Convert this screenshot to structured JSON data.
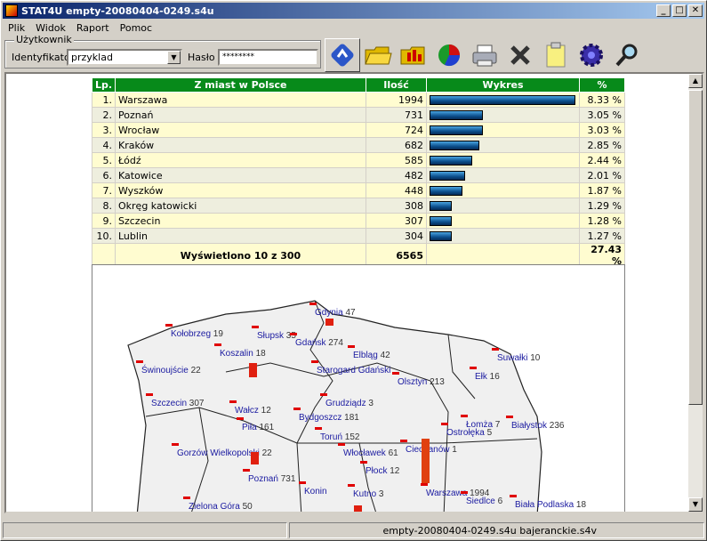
{
  "window": {
    "title": "STAT4U empty-20080404-0249.s4u"
  },
  "menu": [
    "Plik",
    "Widok",
    "Raport",
    "Pomoc"
  ],
  "user": {
    "group_label": "Użytkownik",
    "id_label": "Identyfikator",
    "id_value": "przyklad",
    "pwd_label": "Hasło",
    "pwd_value": "********"
  },
  "toolbar": [
    "refresh-icon",
    "open-folder-icon",
    "open-chart-folder-icon",
    "pie-chart-icon",
    "printer-icon",
    "delete-icon",
    "clipboard-icon",
    "settings-gear-icon",
    "search-icon"
  ],
  "table": {
    "headers": [
      "Lp.",
      "Z miast w Polsce",
      "Ilość",
      "Wykres",
      "%"
    ],
    "rows": [
      {
        "lp": "1.",
        "city": "Warszawa",
        "count": "1994",
        "share": 1.0,
        "pct": "8.33 %"
      },
      {
        "lp": "2.",
        "city": "Poznań",
        "count": "731",
        "share": 0.367,
        "pct": "3.05 %"
      },
      {
        "lp": "3.",
        "city": "Wrocław",
        "count": "724",
        "share": 0.363,
        "pct": "3.03 %"
      },
      {
        "lp": "4.",
        "city": "Kraków",
        "count": "682",
        "share": 0.342,
        "pct": "2.85 %"
      },
      {
        "lp": "5.",
        "city": "Łódź",
        "count": "585",
        "share": 0.293,
        "pct": "2.44 %"
      },
      {
        "lp": "6.",
        "city": "Katowice",
        "count": "482",
        "share": 0.242,
        "pct": "2.01 %"
      },
      {
        "lp": "7.",
        "city": "Wyszków",
        "count": "448",
        "share": 0.225,
        "pct": "1.87 %"
      },
      {
        "lp": "8.",
        "city": "Okręg katowicki",
        "count": "308",
        "share": 0.154,
        "pct": "1.29 %"
      },
      {
        "lp": "9.",
        "city": "Szczecin",
        "count": "307",
        "share": 0.154,
        "pct": "1.28 %"
      },
      {
        "lp": "10.",
        "city": "Lublin",
        "count": "304",
        "share": 0.152,
        "pct": "1.27 %"
      }
    ],
    "footer": {
      "label": "Wyświetlono 10 z 300",
      "total": "6565",
      "pct": "27.43 %"
    }
  },
  "map": {
    "labels": [
      {
        "city": "Gdynia",
        "n": "47"
      },
      {
        "city": "Kołobrzeg",
        "n": "19"
      },
      {
        "city": "Słupsk",
        "n": "35"
      },
      {
        "city": "Gdańsk",
        "n": "274"
      },
      {
        "city": "Koszalin",
        "n": "18"
      },
      {
        "city": "Elbląg",
        "n": "42"
      },
      {
        "city": "Suwałki",
        "n": "10"
      },
      {
        "city": "Świnoujście",
        "n": "22"
      },
      {
        "city": "Starogard Gdański",
        "n": ""
      },
      {
        "city": "Olsztyn",
        "n": "213"
      },
      {
        "city": "Ełk",
        "n": "16"
      },
      {
        "city": "Szczecin",
        "n": "307"
      },
      {
        "city": "Grudziądz",
        "n": "3"
      },
      {
        "city": "Wałcz",
        "n": "12"
      },
      {
        "city": "Bydgoszcz",
        "n": "181"
      },
      {
        "city": "Łomża",
        "n": "7"
      },
      {
        "city": "Piła",
        "n": "161"
      },
      {
        "city": "Ostrołęka",
        "n": "5"
      },
      {
        "city": "Białystok",
        "n": "236"
      },
      {
        "city": "Toruń",
        "n": "152"
      },
      {
        "city": "Ciechanów",
        "n": "1"
      },
      {
        "city": "Gorzów Wielkopolski",
        "n": "22"
      },
      {
        "city": "Włocławek",
        "n": "61"
      },
      {
        "city": "Płock",
        "n": "12"
      },
      {
        "city": "Poznań",
        "n": "731"
      },
      {
        "city": "Konin",
        "n": ""
      },
      {
        "city": "Kutno",
        "n": "3"
      },
      {
        "city": "Warszawa",
        "n": "1994"
      },
      {
        "city": "Siedlce",
        "n": "6"
      },
      {
        "city": "Biała Podlaska",
        "n": "18"
      },
      {
        "city": "Zielona Góra",
        "n": "50"
      }
    ]
  },
  "status": {
    "left": "",
    "file": "empty-20080404-0249.s4u",
    "profile": "bajeranckie.s4v"
  }
}
